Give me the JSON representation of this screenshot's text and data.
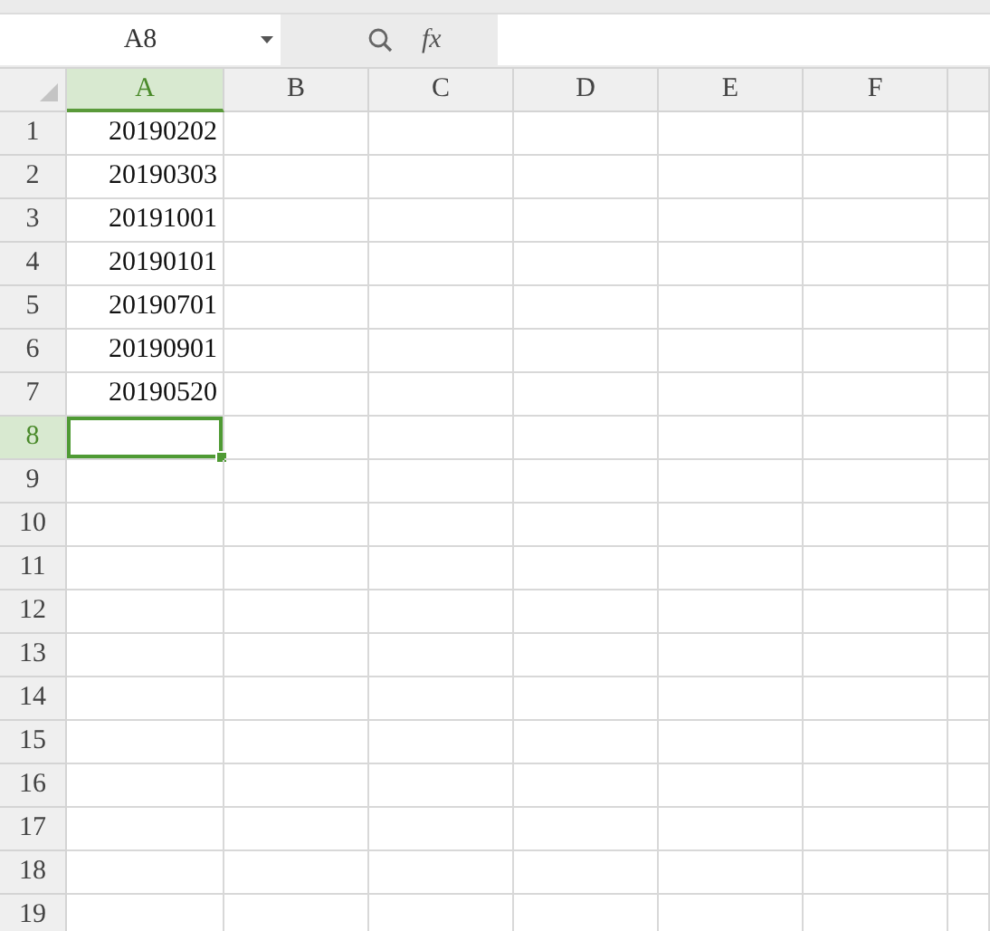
{
  "name_box": {
    "value": "A8"
  },
  "formula_bar": {
    "function_label": "fx"
  },
  "columns": [
    {
      "label": "A",
      "selected": true
    },
    {
      "label": "B",
      "selected": false
    },
    {
      "label": "C",
      "selected": false
    },
    {
      "label": "D",
      "selected": false
    },
    {
      "label": "E",
      "selected": false
    },
    {
      "label": "F",
      "selected": false
    }
  ],
  "rows": [
    {
      "number": "1",
      "selected": false,
      "cells": [
        "20190202"
      ]
    },
    {
      "number": "2",
      "selected": false,
      "cells": [
        "20190303"
      ]
    },
    {
      "number": "3",
      "selected": false,
      "cells": [
        "20191001"
      ]
    },
    {
      "number": "4",
      "selected": false,
      "cells": [
        "20190101"
      ]
    },
    {
      "number": "5",
      "selected": false,
      "cells": [
        "20190701"
      ]
    },
    {
      "number": "6",
      "selected": false,
      "cells": [
        "20190901"
      ]
    },
    {
      "number": "7",
      "selected": false,
      "cells": [
        "20190520"
      ]
    },
    {
      "number": "8",
      "selected": true,
      "cells": []
    },
    {
      "number": "9",
      "selected": false,
      "cells": []
    },
    {
      "number": "10",
      "selected": false,
      "cells": []
    },
    {
      "number": "11",
      "selected": false,
      "cells": []
    },
    {
      "number": "12",
      "selected": false,
      "cells": []
    },
    {
      "number": "13",
      "selected": false,
      "cells": []
    },
    {
      "number": "14",
      "selected": false,
      "cells": []
    },
    {
      "number": "15",
      "selected": false,
      "cells": []
    },
    {
      "number": "16",
      "selected": false,
      "cells": []
    },
    {
      "number": "17",
      "selected": false,
      "cells": []
    },
    {
      "number": "18",
      "selected": false,
      "cells": []
    },
    {
      "number": "19",
      "selected": false,
      "cells": []
    }
  ]
}
